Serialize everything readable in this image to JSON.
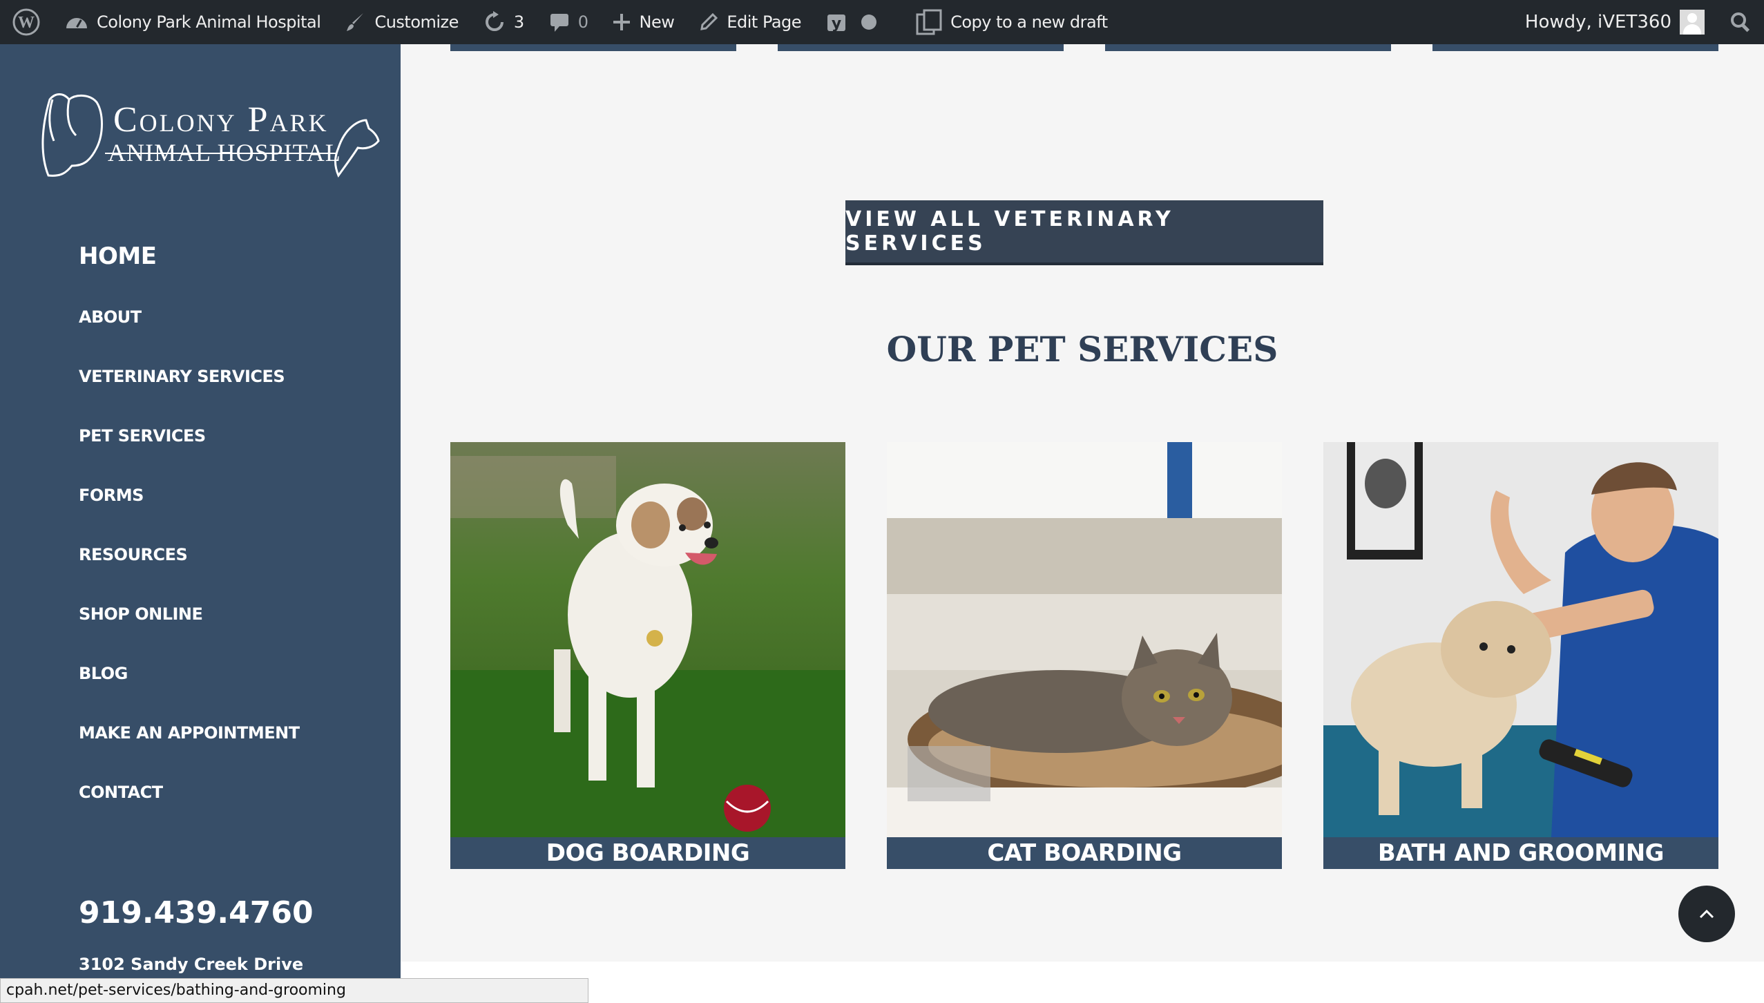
{
  "adminbar": {
    "site_name": "Colony Park Animal Hospital",
    "customize": "Customize",
    "updates_count": "3",
    "comments_count": "0",
    "new_label": "New",
    "edit_page": "Edit Page",
    "copy_draft": "Copy to a new draft",
    "howdy": "Howdy, iVET360"
  },
  "logo": {
    "line1": "Colony Park",
    "line2": "ANIMAL HOSPITAL"
  },
  "sidebar": {
    "nav": [
      "HOME",
      "ABOUT",
      "VETERINARY SERVICES",
      "PET SERVICES",
      "FORMS",
      "RESOURCES",
      "SHOP ONLINE",
      "BLOG",
      "MAKE AN APPOINTMENT",
      "CONTACT"
    ],
    "phone": "919.439.4760",
    "address": "3102 Sandy Creek Drive"
  },
  "main": {
    "cta_label": "VIEW ALL VETERINARY SERVICES",
    "section_title": "OUR PET SERVICES",
    "cards": [
      {
        "caption": "DOG BOARDING"
      },
      {
        "caption": "CAT BOARDING"
      },
      {
        "caption": "BATH AND GROOMING"
      }
    ]
  },
  "status_url": "cpah.net/pet-services/bathing-and-grooming",
  "colors": {
    "sidebar": "#374e68",
    "adminbar": "#23282d",
    "cta": "#364354",
    "title": "#2f3f55"
  }
}
